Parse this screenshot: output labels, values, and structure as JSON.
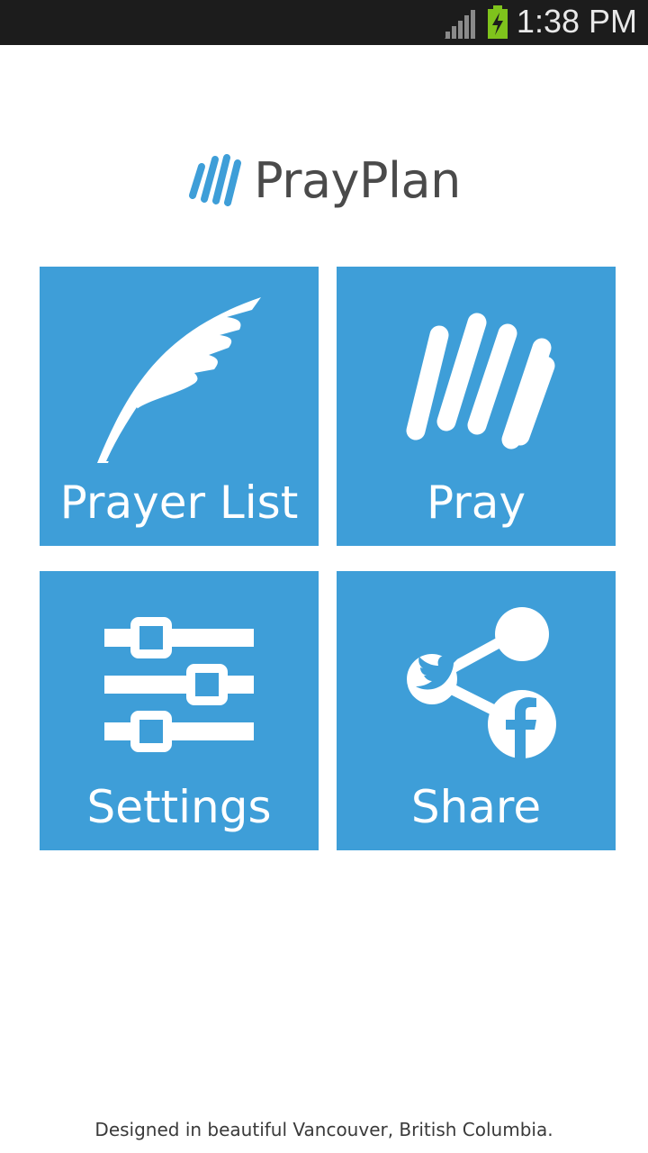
{
  "status_bar": {
    "time": "1:38 PM",
    "signal_icon": "signal-bars-icon",
    "battery_icon": "battery-charging-icon"
  },
  "app": {
    "name": "PrayPlan",
    "logo_icon": "prayplan-hand-icon",
    "brand_color": "#3e9ed8"
  },
  "tiles": [
    {
      "label": "Prayer List",
      "icon": "feather-quill-icon"
    },
    {
      "label": "Pray",
      "icon": "praying-hand-icon"
    },
    {
      "label": "Settings",
      "icon": "sliders-icon"
    },
    {
      "label": "Share",
      "icon": "share-social-icon"
    }
  ],
  "footer": {
    "text": "Designed in beautiful Vancouver, British Columbia."
  }
}
